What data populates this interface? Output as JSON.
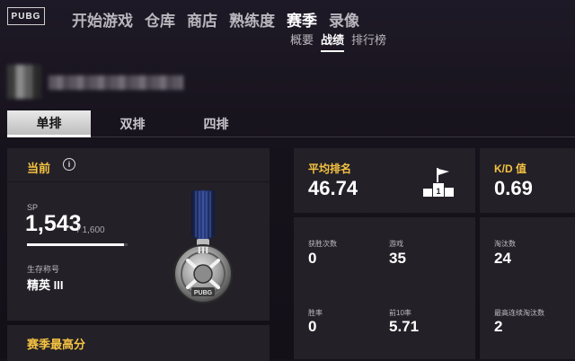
{
  "nav": {
    "logo": "PUBG",
    "items": [
      "开始游戏",
      "仓库",
      "商店",
      "熟练度",
      "赛季",
      "录像"
    ],
    "active_index": 4
  },
  "subnav": {
    "items": [
      "概要",
      "战绩",
      "排行榜"
    ],
    "active_index": 1
  },
  "modes": {
    "items": [
      "单排",
      "双排",
      "四排"
    ],
    "active_index": 0
  },
  "current": {
    "title": "当前",
    "sp_label": "SP",
    "sp_value": "1,543",
    "sp_max": "/ 1,600",
    "sp_progress": 0.964,
    "rank_label": "生存称号",
    "rank_value": "精英 III",
    "medal_tier": "III",
    "medal_text": "PUBG"
  },
  "season_best": {
    "title": "赛季最高分"
  },
  "avg_rank": {
    "title": "平均排名",
    "value": "46.74"
  },
  "kd": {
    "title": "K/D 值",
    "value": "0.69"
  },
  "stats": {
    "wins_label": "获胜次数",
    "wins": "0",
    "games_label": "游戏",
    "games": "35",
    "kills_label": "淘汰数",
    "kills": "24",
    "winrate_label": "胜率",
    "winrate": "0",
    "top10_label": "前10率",
    "top10": "5.71",
    "streak_label": "最高连续淘汰数",
    "streak": "2"
  },
  "colors": {
    "accent": "#f5c242",
    "panel": "#232027",
    "background": "#17131c"
  }
}
